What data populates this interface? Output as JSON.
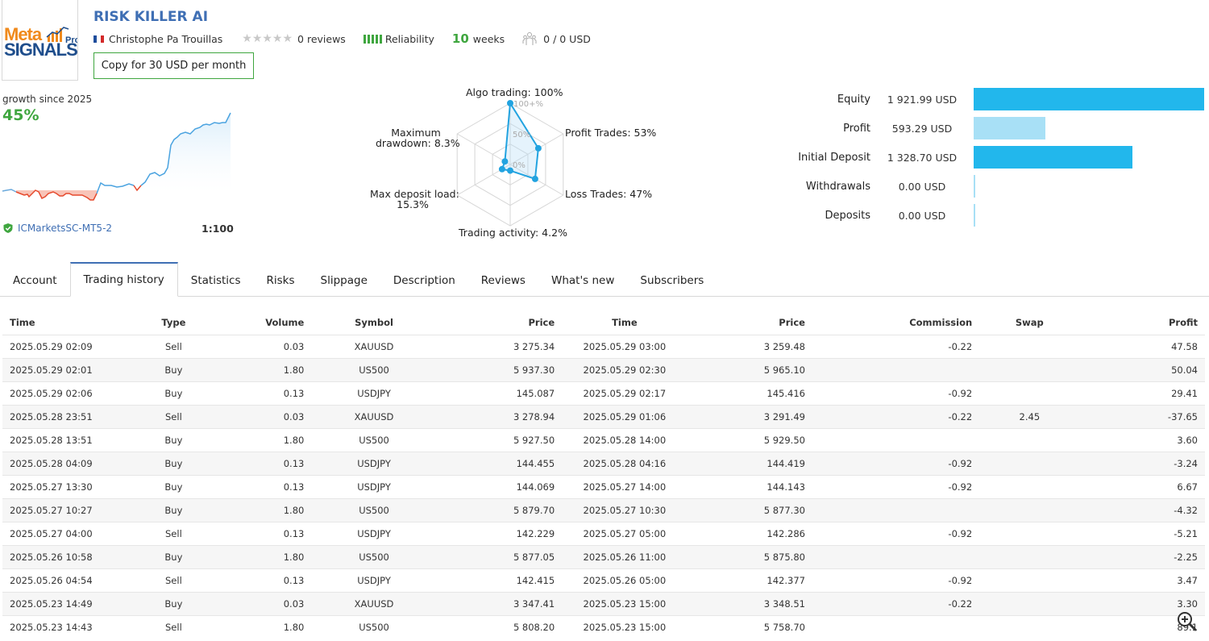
{
  "header": {
    "logo_top": "Meta",
    "logo_bottom": "SIGNALS",
    "logo_pro": "Pro",
    "title": "RISK KILLER AI",
    "author": "Christophe Pa Trouillas",
    "reviews": "0 reviews",
    "reliability_label": "Reliability",
    "weeks_num": "10",
    "weeks_label": "weeks",
    "subscribers": "0 / 0 USD",
    "copy_button": "Copy for 30 USD per month"
  },
  "growth": {
    "label": "growth since 2025",
    "value": "45%",
    "broker": "ICMarketsSC-MT5-2",
    "leverage": "1:100"
  },
  "radar": {
    "algo": "Algo trading: 100%",
    "profit_trades": "Profit Trades: 53%",
    "loss_trades": "Loss Trades: 47%",
    "trading_activity": "Trading activity: 4.2%",
    "max_deposit_load_1": "Max deposit load:",
    "max_deposit_load_2": "15.3%",
    "max_drawdown_1": "Maximum",
    "max_drawdown_2": "drawdown: 8.3%",
    "scale_100": "100+%",
    "scale_50": "50%",
    "scale_0": "0%",
    "values": {
      "algo": 1.0,
      "profit": 0.53,
      "loss": 0.47,
      "activity": 0.042,
      "deposit_load": 0.153,
      "drawdown": 0.083
    }
  },
  "balance": [
    {
      "label": "Equity",
      "value": "1 921.99 USD",
      "ratio": 1.0,
      "color": "#22b7ec"
    },
    {
      "label": "Profit",
      "value": "593.29 USD",
      "ratio": 0.31,
      "color": "#a8e0f6"
    },
    {
      "label": "Initial Deposit",
      "value": "1 328.70 USD",
      "ratio": 0.69,
      "color": "#22b7ec"
    },
    {
      "label": "Withdrawals",
      "value": "0.00 USD",
      "ratio": 0,
      "color": "#a8e0f6"
    },
    {
      "label": "Deposits",
      "value": "0.00 USD",
      "ratio": 0,
      "color": "#a8e0f6"
    }
  ],
  "tabs": [
    "Account",
    "Trading history",
    "Statistics",
    "Risks",
    "Slippage",
    "Description",
    "Reviews",
    "What's new",
    "Subscribers"
  ],
  "active_tab": "Trading history",
  "table": {
    "headers": [
      "Time",
      "Type",
      "Volume",
      "Symbol",
      "Price",
      "Time",
      "Price",
      "Commission",
      "Swap",
      "Profit"
    ],
    "rows": [
      [
        "2025.05.29 02:09",
        "Sell",
        "0.03",
        "XAUUSD",
        "3 275.34",
        "2025.05.29 03:00",
        "3 259.48",
        "-0.22",
        "",
        "47.58"
      ],
      [
        "2025.05.29 02:01",
        "Buy",
        "1.80",
        "US500",
        "5 937.30",
        "2025.05.29 02:30",
        "5 965.10",
        "",
        "",
        "50.04"
      ],
      [
        "2025.05.29 02:06",
        "Buy",
        "0.13",
        "USDJPY",
        "145.087",
        "2025.05.29 02:17",
        "145.416",
        "-0.92",
        "",
        "29.41"
      ],
      [
        "2025.05.28 23:51",
        "Sell",
        "0.03",
        "XAUUSD",
        "3 278.94",
        "2025.05.29 01:06",
        "3 291.49",
        "-0.22",
        "2.45",
        "-37.65"
      ],
      [
        "2025.05.28 13:51",
        "Buy",
        "1.80",
        "US500",
        "5 927.50",
        "2025.05.28 14:00",
        "5 929.50",
        "",
        "",
        "3.60"
      ],
      [
        "2025.05.28 04:09",
        "Buy",
        "0.13",
        "USDJPY",
        "144.455",
        "2025.05.28 04:16",
        "144.419",
        "-0.92",
        "",
        "-3.24"
      ],
      [
        "2025.05.27 13:30",
        "Buy",
        "0.13",
        "USDJPY",
        "144.069",
        "2025.05.27 14:00",
        "144.143",
        "-0.92",
        "",
        "6.67"
      ],
      [
        "2025.05.27 10:27",
        "Buy",
        "1.80",
        "US500",
        "5 879.70",
        "2025.05.27 10:30",
        "5 877.30",
        "",
        "",
        "-4.32"
      ],
      [
        "2025.05.27 04:00",
        "Sell",
        "0.13",
        "USDJPY",
        "142.229",
        "2025.05.27 05:00",
        "142.286",
        "-0.92",
        "",
        "-5.21"
      ],
      [
        "2025.05.26 10:58",
        "Buy",
        "1.80",
        "US500",
        "5 877.05",
        "2025.05.26 11:00",
        "5 875.80",
        "",
        "",
        "-2.25"
      ],
      [
        "2025.05.26 04:54",
        "Sell",
        "0.13",
        "USDJPY",
        "142.415",
        "2025.05.26 05:00",
        "142.377",
        "-0.92",
        "",
        "3.47"
      ],
      [
        "2025.05.23 14:49",
        "Buy",
        "0.03",
        "XAUUSD",
        "3 347.41",
        "2025.05.23 15:00",
        "3 348.51",
        "-0.22",
        "",
        "3.30"
      ],
      [
        "2025.05.23 14:43",
        "Sell",
        "1.80",
        "US500",
        "5 808.20",
        "2025.05.23 15:00",
        "5 758.70",
        "",
        "",
        "89.1"
      ]
    ]
  }
}
